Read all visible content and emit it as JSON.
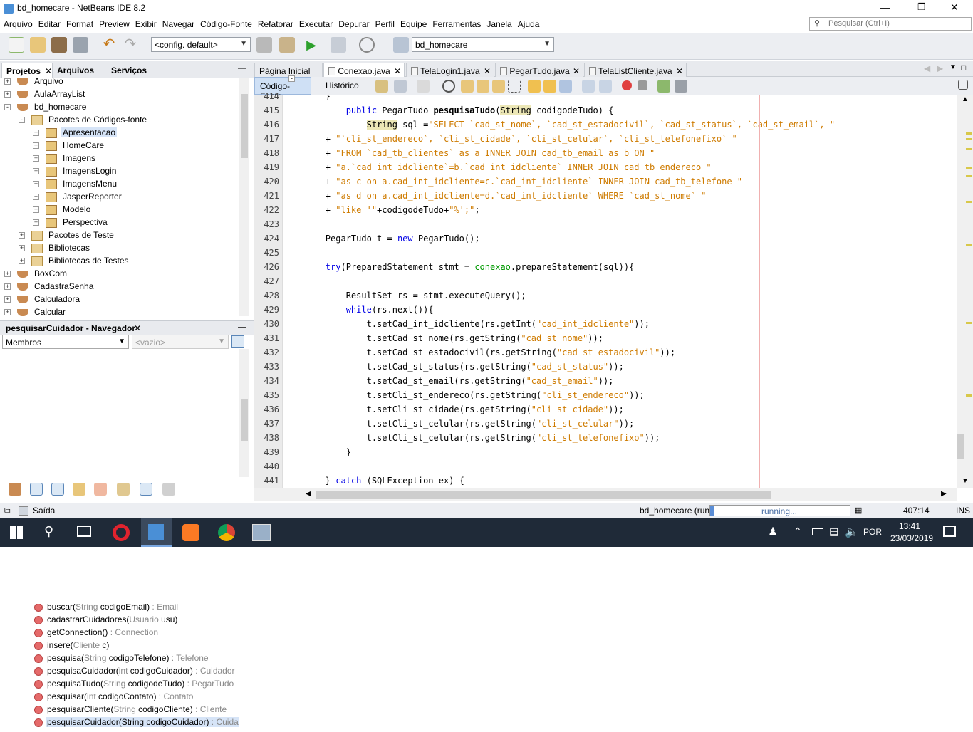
{
  "window": {
    "title": "bd_homecare - NetBeans IDE 8.2",
    "minimize": "—",
    "maximize": "❐",
    "close": "✕"
  },
  "menu": [
    "Arquivo",
    "Editar",
    "Format",
    "Preview",
    "Exibir",
    "Navegar",
    "Código-Fonte",
    "Refatorar",
    "Executar",
    "Depurar",
    "Perfil",
    "Equipe",
    "Ferramentas",
    "Janela",
    "Ajuda"
  ],
  "search": {
    "placeholder": "Pesquisar (Ctrl+I)"
  },
  "toolbar": {
    "config": "<config. default>",
    "project": "bd_homecare"
  },
  "projects": {
    "tabs": [
      "Projetos",
      "Arquivos",
      "Serviços"
    ],
    "items": [
      {
        "label": "Arquivo",
        "level": 0,
        "icon": "project",
        "exp": "+"
      },
      {
        "label": "AulaArrayList",
        "level": 0,
        "icon": "project",
        "exp": "+"
      },
      {
        "label": "bd_homecare",
        "level": 0,
        "icon": "project",
        "exp": "-"
      },
      {
        "label": "Pacotes de Códigos-fonte",
        "level": 1,
        "icon": "folder",
        "exp": "-"
      },
      {
        "label": "Apresentacao",
        "level": 2,
        "icon": "package",
        "exp": "+",
        "selected": true
      },
      {
        "label": "HomeCare",
        "level": 2,
        "icon": "package",
        "exp": "+"
      },
      {
        "label": "Imagens",
        "level": 2,
        "icon": "package",
        "exp": "+"
      },
      {
        "label": "ImagensLogin",
        "level": 2,
        "icon": "package",
        "exp": "+"
      },
      {
        "label": "ImagensMenu",
        "level": 2,
        "icon": "package",
        "exp": "+"
      },
      {
        "label": "JasperReporter",
        "level": 2,
        "icon": "package",
        "exp": "+"
      },
      {
        "label": "Modelo",
        "level": 2,
        "icon": "package",
        "exp": "+"
      },
      {
        "label": "Perspectiva",
        "level": 2,
        "icon": "package",
        "exp": "+"
      },
      {
        "label": "Pacotes de Teste",
        "level": 1,
        "icon": "folder",
        "exp": "+"
      },
      {
        "label": "Bibliotecas",
        "level": 1,
        "icon": "folder",
        "exp": "+"
      },
      {
        "label": "Bibliotecas de Testes",
        "level": 1,
        "icon": "folder",
        "exp": "+"
      },
      {
        "label": "BoxCom",
        "level": 0,
        "icon": "project",
        "exp": "+"
      },
      {
        "label": "CadastraSenha",
        "level": 0,
        "icon": "project",
        "exp": "+"
      },
      {
        "label": "Calculadora",
        "level": 0,
        "icon": "project",
        "exp": "+"
      },
      {
        "label": "Calcular",
        "level": 0,
        "icon": "project",
        "exp": "+"
      }
    ]
  },
  "navigator": {
    "title": "pesquisarCuidador - Navegador",
    "filter": "Membros",
    "empty": "<vazio>",
    "items": [
      {
        "name": "buscar(",
        "type": "String",
        "param": " codigoEmail)",
        "ret": " : Email"
      },
      {
        "name": "cadastrarCuidadores(",
        "type": "Usuario",
        "param": " usu)",
        "ret": ""
      },
      {
        "name": "getConnection()",
        "type": "",
        "param": "",
        "ret": " : Connection"
      },
      {
        "name": "insere(",
        "type": "Cliente",
        "param": " c)",
        "ret": ""
      },
      {
        "name": "pesquisa(",
        "type": "String",
        "param": " codigoTelefone)",
        "ret": " : Telefone"
      },
      {
        "name": "pesquisaCuidador(",
        "type": "int",
        "param": " codigoCuidador)",
        "ret": " : Cuidador"
      },
      {
        "name": "pesquisaTudo(",
        "type": "String",
        "param": " codigodeTudo)",
        "ret": " : PegarTudo"
      },
      {
        "name": "pesquisar(",
        "type": "int",
        "param": " codigoContato)",
        "ret": " : Contato"
      },
      {
        "name": "pesquisarCliente(",
        "type": "String",
        "param": " codigoCliente)",
        "ret": " : Cliente"
      },
      {
        "name": "pesquisarCuidador(String codigoCuidador)",
        "type": "",
        "param": "",
        "ret": " : Cuidador",
        "selected": true
      }
    ]
  },
  "editor": {
    "tabs": [
      "Página Inicial",
      "Conexao.java",
      "TelaLogin1.java",
      "PegarTudo.java",
      "TelaListCliente.java"
    ],
    "active_tab": 1,
    "view_tabs": [
      "Código-Fonte",
      "Histórico"
    ],
    "lines": [
      {
        "n": "414",
        "segs": [
          [
            "",
            "        }"
          ]
        ]
      },
      {
        "n": "415",
        "segs": [
          [
            "",
            "            "
          ],
          [
            "kw",
            "public"
          ],
          [
            "",
            " PegarTudo "
          ],
          [
            "b",
            "pesquisaTudo"
          ],
          [
            "",
            "("
          ],
          [
            "ty",
            "String"
          ],
          [
            "",
            " codigodeTudo) {"
          ]
        ]
      },
      {
        "n": "416",
        "segs": [
          [
            "",
            "                "
          ],
          [
            "ty",
            "String"
          ],
          [
            "",
            " sql ="
          ],
          [
            "str",
            "\"SELECT `cad_st_nome`, `cad_st_estadocivil`, `cad_st_status`, `cad_st_email`, \""
          ]
        ]
      },
      {
        "n": "417",
        "segs": [
          [
            "",
            "        + "
          ],
          [
            "str",
            "\"`cli_st_endereco`, `cli_st_cidade`, `cli_st_celular`, `cli_st_telefonefixo` \""
          ]
        ]
      },
      {
        "n": "418",
        "segs": [
          [
            "",
            "        + "
          ],
          [
            "str",
            "\"FROM `cad_tb_clientes` as a INNER JOIN cad_tb_email as b ON \""
          ]
        ]
      },
      {
        "n": "419",
        "segs": [
          [
            "",
            "        + "
          ],
          [
            "str",
            "\"a.`cad_int_idcliente`=b.`cad_int_idcliente` INNER JOIN cad_tb_endereco \""
          ]
        ]
      },
      {
        "n": "420",
        "segs": [
          [
            "",
            "        + "
          ],
          [
            "str",
            "\"as c on a.cad_int_idcliente=c.`cad_int_idcliente` INNER JOIN cad_tb_telefone \""
          ]
        ]
      },
      {
        "n": "421",
        "segs": [
          [
            "",
            "        + "
          ],
          [
            "str",
            "\"as d on a.cad_int_idcliente=d.`cad_int_idcliente` WHERE `cad_st_nome` \""
          ]
        ]
      },
      {
        "n": "422",
        "segs": [
          [
            "",
            "        + "
          ],
          [
            "str",
            "\"like '\""
          ],
          [
            "",
            "+codigodeTudo+"
          ],
          [
            "str",
            "\"%';\""
          ],
          [
            "",
            ";"
          ]
        ]
      },
      {
        "n": "423",
        "segs": [
          [
            "",
            ""
          ]
        ]
      },
      {
        "n": "424",
        "segs": [
          [
            "",
            "        PegarTudo t = "
          ],
          [
            "kw",
            "new"
          ],
          [
            "",
            " PegarTudo();"
          ]
        ]
      },
      {
        "n": "425",
        "segs": [
          [
            "",
            ""
          ]
        ]
      },
      {
        "n": "426",
        "segs": [
          [
            "",
            "        "
          ],
          [
            "kw",
            "try"
          ],
          [
            "",
            "(PreparedStatement stmt = "
          ],
          [
            "fld",
            "conexao"
          ],
          [
            "",
            ".prepareStatement(sql)){"
          ]
        ]
      },
      {
        "n": "427",
        "segs": [
          [
            "",
            ""
          ]
        ]
      },
      {
        "n": "428",
        "segs": [
          [
            "",
            "            ResultSet rs = stmt.executeQuery();"
          ]
        ]
      },
      {
        "n": "429",
        "segs": [
          [
            "",
            "            "
          ],
          [
            "kw",
            "while"
          ],
          [
            "",
            "(rs.next()){"
          ]
        ]
      },
      {
        "n": "430",
        "segs": [
          [
            "",
            "                t.setCad_int_idcliente(rs.getInt("
          ],
          [
            "str",
            "\"cad_int_idcliente\""
          ],
          [
            "",
            "));"
          ]
        ]
      },
      {
        "n": "431",
        "segs": [
          [
            "",
            "                t.setCad_st_nome(rs.getString("
          ],
          [
            "str",
            "\"cad_st_nome\""
          ],
          [
            "",
            "));"
          ]
        ]
      },
      {
        "n": "432",
        "segs": [
          [
            "",
            "                t.setCad_st_estadocivil(rs.getString("
          ],
          [
            "str",
            "\"cad_st_estadocivil\""
          ],
          [
            "",
            "));"
          ]
        ]
      },
      {
        "n": "433",
        "segs": [
          [
            "",
            "                t.setCad_st_status(rs.getString("
          ],
          [
            "str",
            "\"cad_st_status\""
          ],
          [
            "",
            "));"
          ]
        ]
      },
      {
        "n": "434",
        "segs": [
          [
            "",
            "                t.setCad_st_email(rs.getString("
          ],
          [
            "str",
            "\"cad_st_email\""
          ],
          [
            "",
            "));"
          ]
        ]
      },
      {
        "n": "435",
        "segs": [
          [
            "",
            "                t.setCli_st_endereco(rs.getString("
          ],
          [
            "str",
            "\"cli_st_endereco\""
          ],
          [
            "",
            "));"
          ]
        ]
      },
      {
        "n": "436",
        "segs": [
          [
            "",
            "                t.setCli_st_cidade(rs.getString("
          ],
          [
            "str",
            "\"cli_st_cidade\""
          ],
          [
            "",
            "));"
          ]
        ]
      },
      {
        "n": "437",
        "segs": [
          [
            "",
            "                t.setCli_st_celular(rs.getString("
          ],
          [
            "str",
            "\"cli_st_celular\""
          ],
          [
            "",
            "));"
          ]
        ]
      },
      {
        "n": "438",
        "segs": [
          [
            "",
            "                t.setCli_st_celular(rs.getString("
          ],
          [
            "str",
            "\"cli_st_telefonefixo\""
          ],
          [
            "",
            "));"
          ]
        ]
      },
      {
        "n": "439",
        "segs": [
          [
            "",
            "            }"
          ]
        ]
      },
      {
        "n": "440",
        "segs": [
          [
            "",
            ""
          ]
        ]
      },
      {
        "n": "441",
        "segs": [
          [
            "",
            "        } "
          ],
          [
            "kw",
            "catch"
          ],
          [
            "",
            " (SQLException ex) {"
          ]
        ]
      }
    ]
  },
  "status": {
    "output": "Saída",
    "project_run": "bd_homecare (run)",
    "progress": "running...",
    "position": "407:14",
    "mode": "INS"
  },
  "taskbar": {
    "lang": "POR",
    "time": "13:41",
    "date": "23/03/2019"
  },
  "colors": {
    "keyword": "#0000e6",
    "string": "#ce7b00",
    "field": "#009900",
    "selection": "#d6e4f7",
    "taskbar": "#1f2a38"
  }
}
